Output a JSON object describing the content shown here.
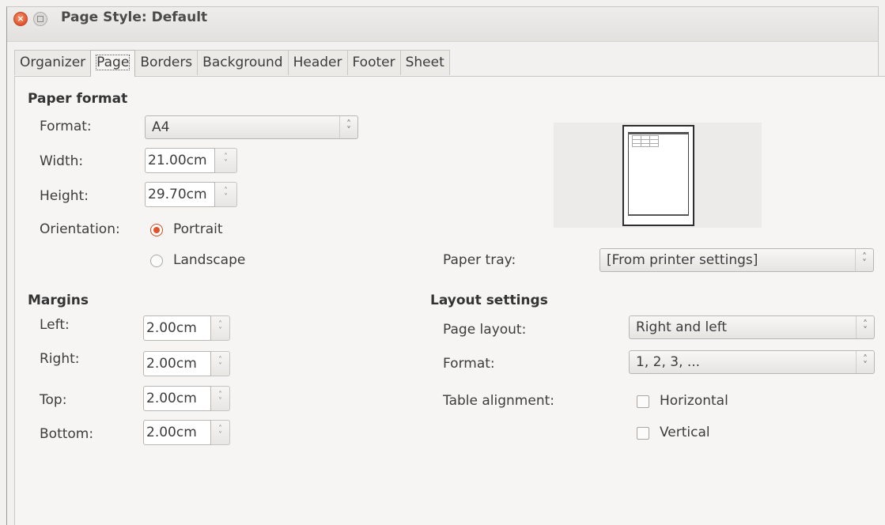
{
  "window": {
    "title": "Page Style: Default"
  },
  "tabs": [
    "Organizer",
    "Page",
    "Borders",
    "Background",
    "Header",
    "Footer",
    "Sheet"
  ],
  "active_tab": "Page",
  "paper_format": {
    "heading": "Paper format",
    "format_label": "Format:",
    "format_value": "A4",
    "width_label": "Width:",
    "width_value": "21.00cm",
    "height_label": "Height:",
    "height_value": "29.70cm",
    "orientation_label": "Orientation:",
    "portrait_label": "Portrait",
    "portrait_selected": true,
    "landscape_label": "Landscape",
    "landscape_selected": false,
    "paper_tray_label": "Paper tray:",
    "paper_tray_value": "[From printer settings]"
  },
  "margins": {
    "heading": "Margins",
    "left_label": "Left:",
    "left_value": "2.00cm",
    "right_label": "Right:",
    "right_value": "2.00cm",
    "top_label": "Top:",
    "top_value": "2.00cm",
    "bottom_label": "Bottom:",
    "bottom_value": "2.00cm"
  },
  "layout": {
    "heading": "Layout settings",
    "page_layout_label": "Page layout:",
    "page_layout_value": "Right and left",
    "format_label": "Format:",
    "format_value": "1, 2, 3, ...",
    "table_alignment_label": "Table alignment:",
    "horizontal_label": "Horizontal",
    "horizontal_checked": false,
    "vertical_label": "Vertical",
    "vertical_checked": false
  },
  "colors": {
    "accent": "#e1522b",
    "background": "#f2f1f0"
  }
}
